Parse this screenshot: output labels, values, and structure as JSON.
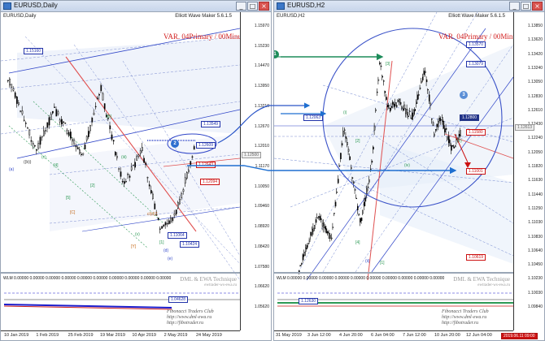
{
  "left_window": {
    "title": "EURUSD,Daily",
    "symbol_line": "EURUSD,Daily",
    "indicator": "Elliott Wave Maker 5.6.1.5",
    "variant_label": "VAR. 04Primary / 00Minute",
    "price_ticks": [
      "1.15970",
      "1.15230",
      "1.14470",
      "1.13950",
      "1.13210",
      "1.12670",
      "1.12010",
      "1.11170",
      "1.10050",
      "1.09460",
      "1.08920",
      "1.08420",
      "1.07580",
      "1.06620",
      "1.05620"
    ],
    "time_ticks": [
      "10 Jan 2019",
      "1 Feb 2019",
      "25 Feb 2019",
      "19 Mar 2019",
      "10 Apr 2019",
      "2 May 2019",
      "24 May 2019"
    ],
    "price_badges": [
      {
        "text": "1.15160",
        "type": "blue"
      },
      {
        "text": "1.13549",
        "type": "blue"
      },
      {
        "text": "1.12609",
        "type": "blue"
      },
      {
        "text": "1.12643",
        "type": "red"
      },
      {
        "text": "1.12094",
        "type": "red"
      },
      {
        "text": "1.11064",
        "type": "blue"
      },
      {
        "text": "1.10424",
        "type": "blue"
      },
      {
        "text": "1.12500",
        "type": "grey"
      }
    ],
    "wave_labels": [
      "(b)",
      "((b))",
      "(c)",
      "[4]",
      "(a)",
      "[5]",
      "[C]",
      "[2]",
      "[B]",
      "(iii)",
      "(v)",
      "[Y]",
      "[1]",
      "(d)",
      "(e)",
      "cl(d)2"
    ],
    "callout_number": "2",
    "sub_window_label": "WLM 0.00000 0.00000 0.00000 0.00000 0.00000 0.00000 0.00000 0.00000 0.00000 0.00000",
    "sub_badge": "1.04628",
    "brand_line1": "DML & EWA Technique",
    "brand_line2": "ewtrader-ws-ewa.ru",
    "club_line1": "Fibonacci    Traders    Club",
    "club_line2": "http://www.dml-ewa.ru",
    "club_line3": "http://fibotrader.ru"
  },
  "right_window": {
    "title": "EURUSD,H2",
    "symbol_line": "EURUSD,H2",
    "indicator": "Elliott Wave Maker 5.6.1.5",
    "variant_label": "VAR. 04Primary / 00Minute",
    "price_ticks": [
      "1.13850",
      "1.13620",
      "1.13420",
      "1.13240",
      "1.13050",
      "1.12830",
      "1.12610",
      "1.12430",
      "1.12240",
      "1.12050",
      "1.11820",
      "1.11630",
      "1.11440",
      "1.11250",
      "1.11030",
      "1.10830",
      "1.10640",
      "1.10450",
      "1.10230",
      "1.10030",
      "1.09840"
    ],
    "time_ticks": [
      "31 May 2019",
      "3 Jun 12:00",
      "4 Jun 20:00",
      "6 Jun 04:00",
      "7 Jun 12:00",
      "10 Jun 20:00",
      "12 Jun 04:00"
    ],
    "price_badges": [
      {
        "text": "1.13570",
        "type": "blue"
      },
      {
        "text": "1.13079",
        "type": "blue"
      },
      {
        "text": "1.12800",
        "type": "darkblue"
      },
      {
        "text": "1.12063",
        "type": "blue"
      },
      {
        "text": "1.11580",
        "type": "red"
      },
      {
        "text": "1.11001",
        "type": "red"
      },
      {
        "text": "1.10619",
        "type": "red"
      },
      {
        "text": "1.12613",
        "type": "grey"
      }
    ],
    "wave_labels": [
      "[3]",
      "(i)",
      "[4]",
      "(ii)",
      "(iv)",
      "(v)",
      "[2]",
      "[1]"
    ],
    "callout_one": "1",
    "callout_three": "3",
    "sub_window_label": "WLM 0.00000 0.00000 0.00000 0.00000 0.00000 0.00000 0.00000 0.00000 0.00000 0.00000",
    "sub_badge": "1.12630",
    "bottom_badge": "2019.06.11 09:00",
    "brand_line1": "DML & EWA Technique",
    "brand_line2": "ewtrader-ws-ewa.ru",
    "club_line1": "Fibonacci    Traders    Club",
    "club_line2": "http://www.dml-ewa.ru",
    "club_line3": "http://fibotrader.ru"
  },
  "window_buttons": {
    "minimize": "_",
    "maximize": "□",
    "close": "×"
  },
  "colors": {
    "bull": "#ffffff",
    "bear": "#000000",
    "wave_blue": "#2f44c8",
    "fib_red": "#e05555",
    "accent_green": "#1d8c5a",
    "arrow_blue": "#1e6fd0"
  }
}
